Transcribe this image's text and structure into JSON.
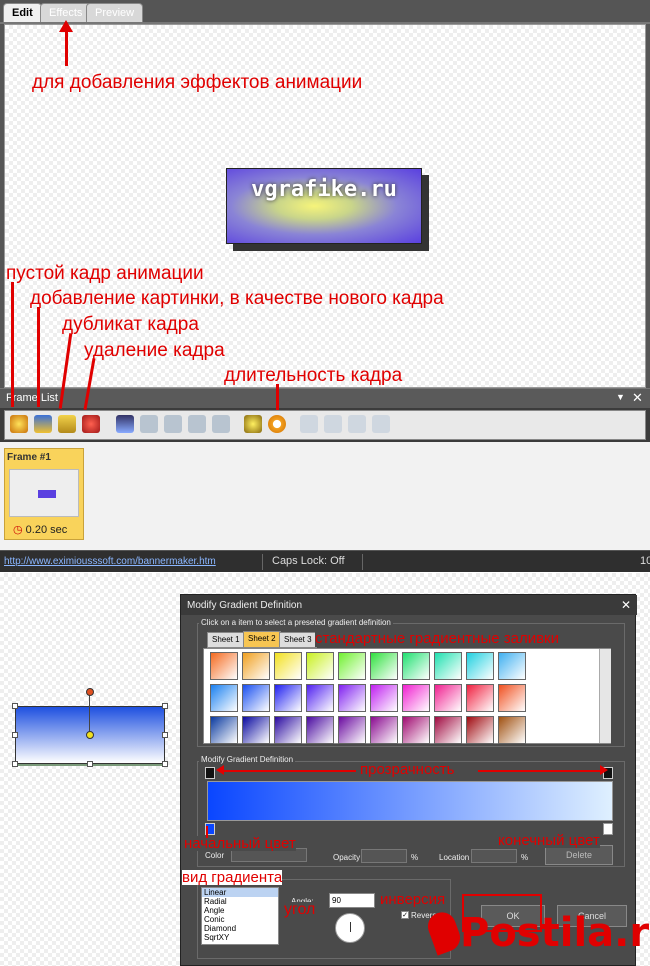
{
  "tabs": [
    "Edit",
    "Effects",
    "Preview"
  ],
  "annotations": {
    "effects": "для добавления эффектов анимации",
    "empty_frame": "пустой кадр анимации",
    "add_image": "добавление картинки, в качестве нового кадра",
    "duplicate": "дубликат кадра",
    "delete": "удаление кадра",
    "duration": "длительность кадра",
    "presets": "стандартные градиентные заливки",
    "transparency": "прозрачность",
    "start_color": "начальный цвет",
    "end_color": "конечный цвет",
    "gradient_type": "вид градиента",
    "angle": "угол",
    "reverse": "инверсия"
  },
  "banner_text": "vgrafike.ru",
  "frame_list": {
    "title": "Frame List",
    "frame_title": "Frame #1",
    "duration": "0.20 sec"
  },
  "status": {
    "url": "http://www.eximiousssoft.com/bannermaker.htm",
    "caps": "Caps Lock: Off",
    "right": "10"
  },
  "dialog": {
    "title": "Modify Gradient Definition",
    "hint": "Click on a item to select a preseted gradient definition",
    "sheets": [
      "Sheet 1",
      "Sheet 2",
      "Sheet 3"
    ],
    "section": "Modify Gradient Definition",
    "color_label": "Color",
    "opacity_label": "Opacity",
    "location_label": "Location",
    "percent": "%",
    "delete_label": "Delete",
    "types": [
      "Linear",
      "Radial",
      "Angle",
      "Conic",
      "Diamond",
      "SqrtXY"
    ],
    "angle_label": "Angle:",
    "angle_value": "90",
    "reverse_label": "Reverse",
    "ok": "OK",
    "cancel": "Cancel"
  },
  "watermark": "Postila.ru",
  "colors": {
    "accent": "#e00000",
    "frame_bg": "#f9d35b"
  }
}
